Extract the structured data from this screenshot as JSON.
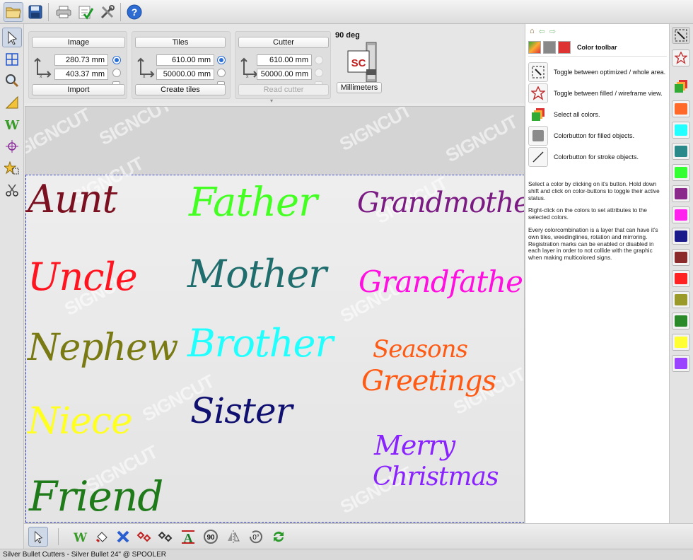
{
  "top_toolbar": {
    "buttons": [
      {
        "name": "open-folder-icon"
      },
      {
        "name": "save-icon"
      },
      {
        "name": "print-icon"
      },
      {
        "name": "checklist-icon"
      },
      {
        "name": "tools-icon"
      },
      {
        "name": "help-icon",
        "label": "?"
      }
    ]
  },
  "params": {
    "image": {
      "button": "Image",
      "x": "280.73 mm",
      "y": "403.37 mm",
      "action": "Import"
    },
    "tiles": {
      "button": "Tiles",
      "x": "610.00 mm",
      "y": "50000.00 mm",
      "action": "Create tiles"
    },
    "cutter": {
      "button": "Cutter",
      "x": "610.00 mm",
      "y": "50000.00 mm",
      "action": "Read cutter"
    },
    "rotation_label": "90 deg",
    "logo_text": "SC",
    "units_button": "Millimeters"
  },
  "canvas": {
    "watermark": "SIGNCUT",
    "words": [
      {
        "text": "Aunt",
        "color": "#7a1020"
      },
      {
        "text": "Father",
        "color": "#44ff22"
      },
      {
        "text": "Grandmother",
        "color": "#7a1a82"
      },
      {
        "text": "Uncle",
        "color": "#ff1420"
      },
      {
        "text": "Mother",
        "color": "#1f6d6d"
      },
      {
        "text": "Grandfather",
        "color": "#ff10e0"
      },
      {
        "text": "Nephew",
        "color": "#7a7a14"
      },
      {
        "text": "Brother",
        "color": "#22ffff"
      },
      {
        "text": "Seasons",
        "color": "#ff5a14"
      },
      {
        "text": "Greetings",
        "color": "#ff5a14"
      },
      {
        "text": "Niece",
        "color": "#ffff22"
      },
      {
        "text": "Sister",
        "color": "#101070"
      },
      {
        "text": "Merry",
        "color": "#8a22ff"
      },
      {
        "text": "Christmas",
        "color": "#8a22ff"
      },
      {
        "text": "Friend",
        "color": "#1f7a1a"
      }
    ]
  },
  "right_panel": {
    "title": "Color toolbar",
    "items": [
      {
        "icon": "optimize-area-icon",
        "text": "Toggle between optimized / whole area."
      },
      {
        "icon": "star-wireframe-icon",
        "text": "Toggle between filled / wireframe view."
      },
      {
        "icon": "select-all-colors-icon",
        "text": "Select all colors."
      },
      {
        "icon": "filled-colorbutton-icon",
        "text": "Colorbutton for filled objects."
      },
      {
        "icon": "stroke-colorbutton-icon",
        "text": "Colorbutton for stroke objects."
      }
    ],
    "help": [
      "Select a color by clicking on it's button. Hold down shift and click on color-buttons to toggle their active status.",
      "Right-click on the colors to set attributes to the selected colors.",
      "Every colorcombination is a layer that can have it's own tiles, weedinglines, rotation and mirroring. Registration marks can be enabled or disabled in each layer in order to not collide with the graphic when making multicolored signs."
    ]
  },
  "color_strip": {
    "colors": [
      "#ff6a2a",
      "#22ffff",
      "#2a8a8a",
      "#33ff33",
      "#8a2a8a",
      "#ff22ee",
      "#1a1a8a",
      "#8a2a2a",
      "#ff2222",
      "#9a9a2a",
      "#2a8a2a",
      "#ffff33",
      "#9a44ff"
    ]
  },
  "bottom_toolbar": {
    "rotate_90_label": "90",
    "rotate_0_label": "0°"
  },
  "status": {
    "text": "Silver Bullet Cutters - Silver Bullet 24\" @ SPOOLER"
  }
}
